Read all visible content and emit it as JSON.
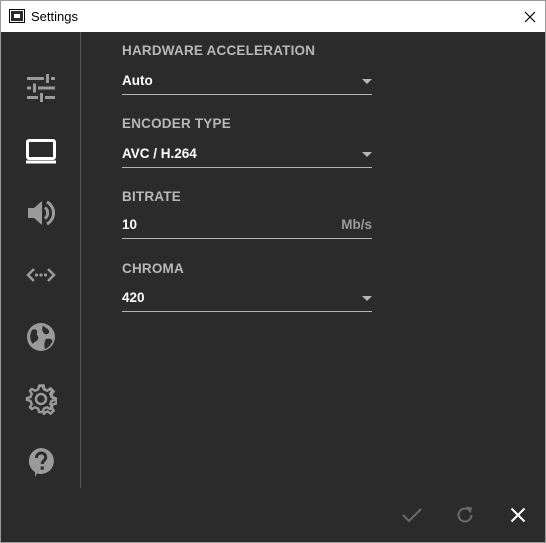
{
  "window": {
    "title": "Settings"
  },
  "sidebar": {
    "items": [
      {
        "name": "general",
        "icon": "sliders-icon",
        "active": false
      },
      {
        "name": "video",
        "icon": "monitor-icon",
        "active": true
      },
      {
        "name": "audio",
        "icon": "speaker-icon",
        "active": false
      },
      {
        "name": "network",
        "icon": "code-arrows-icon",
        "active": false
      },
      {
        "name": "internet",
        "icon": "globe-icon",
        "active": false
      },
      {
        "name": "advanced",
        "icon": "gear-icon",
        "active": false
      },
      {
        "name": "help",
        "icon": "help-icon",
        "active": false
      }
    ]
  },
  "video": {
    "hardware_acceleration": {
      "label": "HARDWARE ACCELERATION",
      "value": "Auto"
    },
    "encoder_type": {
      "label": "ENCODER TYPE",
      "value": "AVC / H.264"
    },
    "bitrate": {
      "label": "BITRATE",
      "value": "10",
      "unit": "Mb/s"
    },
    "chroma": {
      "label": "CHROMA",
      "value": "420"
    }
  },
  "footer": {
    "buttons": [
      "check-icon",
      "refresh-icon",
      "close-icon"
    ]
  },
  "colors": {
    "background": "#2b2b2b",
    "icon": "#9a9a9a",
    "icon_active": "#ffffff",
    "label": "#b8b8b8",
    "value": "#ffffff"
  }
}
